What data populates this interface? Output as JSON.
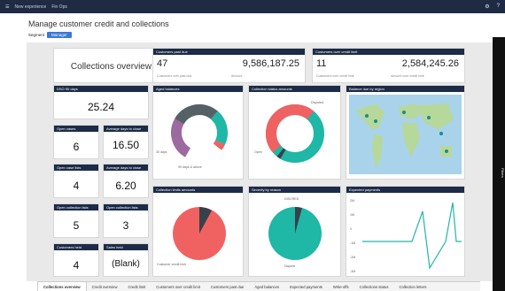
{
  "topbar": {
    "app": "New experience",
    "crumb": "Fin Ops",
    "icons": [
      "settings-icon",
      "help-icon"
    ]
  },
  "page": {
    "title": "Manage customer credit and collections",
    "segment_label": "Segment",
    "segment_value": "Manager"
  },
  "rail": {
    "label": "Filters"
  },
  "overview": {
    "title": "Collections overview"
  },
  "customers_past_due": {
    "header": "Customers past due",
    "count": "47",
    "count_caption": "Customers with past due",
    "amount": "9,586,187.25",
    "amount_caption": "Amount"
  },
  "over_limit": {
    "header": "Customers over credit limit",
    "count": "11",
    "count_caption": "Customers over credit limit",
    "amount": "2,584,245.26",
    "amount_caption": "Amount over credit limit"
  },
  "kpis": [
    {
      "label": "DSO 90 days",
      "value": "25.24"
    },
    {
      "label": "Open cases",
      "value": "6"
    },
    {
      "label": "Average days to close",
      "value": "16.50"
    },
    {
      "label": "Open case lists",
      "value": "4"
    },
    {
      "label": "Average days to close",
      "value": "6.20"
    },
    {
      "label": "Open collection lists",
      "value": "5"
    },
    {
      "label": "Open collection lists",
      "value": "3"
    },
    {
      "label": "Customers held",
      "value": "4"
    },
    {
      "label": "Sales held",
      "value": "(Blank)"
    }
  ],
  "charts": {
    "aged": {
      "header": "Aged balances",
      "labels": [
        "90 days & above",
        "30 days"
      ]
    },
    "status": {
      "header": "Collection status amounts",
      "labels": [
        "Open",
        "Disputed"
      ]
    },
    "region": {
      "header": "Balance due by region"
    },
    "limits": {
      "header": "Collection limits amounts",
      "labels": [
        "Customer credit limit"
      ]
    },
    "severity": {
      "header": "Severity by reason",
      "labels": [
        "DISCRED",
        "Dispute"
      ]
    },
    "payments": {
      "header": "Expected payments",
      "yticks": [
        "2M",
        "1M",
        "0",
        "-1M",
        "-2M",
        "-3M"
      ]
    }
  },
  "tabs": [
    "Collections overview",
    "Credit overview",
    "Credit limit",
    "Customers over credit limit",
    "Customers past due",
    "Aged balances",
    "Expected payments",
    "Write-offs",
    "Collections status",
    "Collection letters"
  ]
}
